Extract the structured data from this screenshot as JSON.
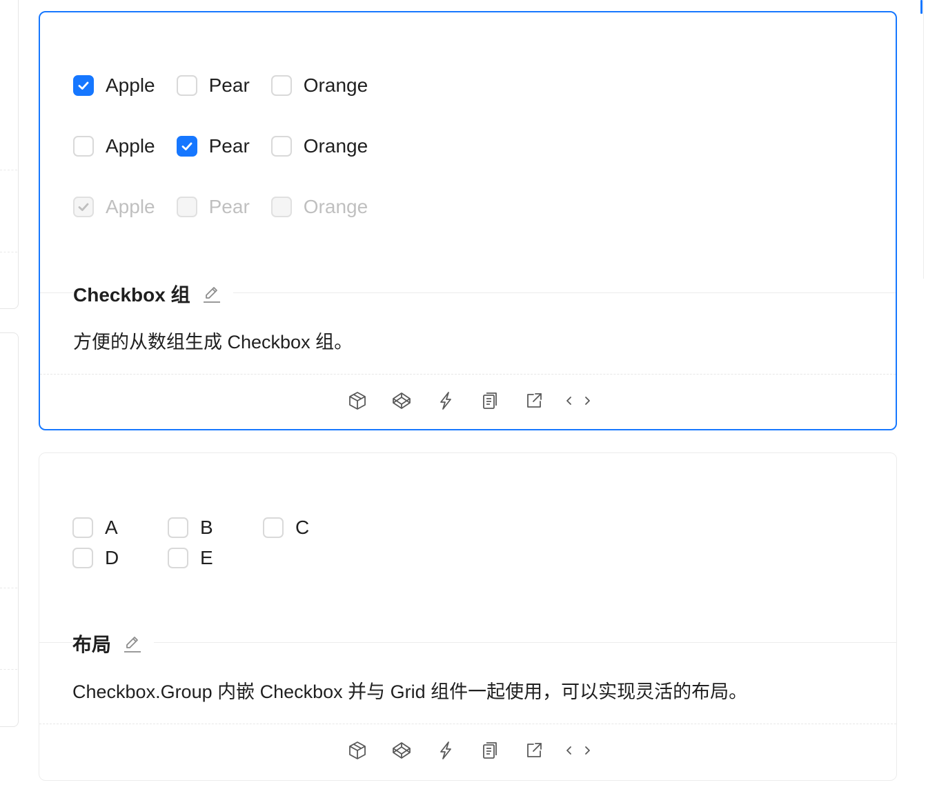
{
  "colors": {
    "primary": "#1677ff",
    "border": "#d9d9d9",
    "disabled_text": "rgba(0,0,0,0.25)"
  },
  "demo1": {
    "rows": [
      [
        {
          "label": "Apple",
          "checked": true,
          "disabled": false
        },
        {
          "label": "Pear",
          "checked": false,
          "disabled": false
        },
        {
          "label": "Orange",
          "checked": false,
          "disabled": false
        }
      ],
      [
        {
          "label": "Apple",
          "checked": false,
          "disabled": false
        },
        {
          "label": "Pear",
          "checked": true,
          "disabled": false
        },
        {
          "label": "Orange",
          "checked": false,
          "disabled": false
        }
      ],
      [
        {
          "label": "Apple",
          "checked": true,
          "disabled": true
        },
        {
          "label": "Pear",
          "checked": false,
          "disabled": true
        },
        {
          "label": "Orange",
          "checked": false,
          "disabled": true
        }
      ]
    ],
    "title": "Checkbox 组",
    "description": "方便的从数组生成 Checkbox 组。"
  },
  "demo2": {
    "items": [
      "A",
      "B",
      "C",
      "D",
      "E"
    ],
    "title": "布局",
    "description": "Checkbox.Group 内嵌 Checkbox 并与 Grid 组件一起使用，可以实现灵活的布局。"
  },
  "actions": [
    "codesandbox-icon",
    "codepen-icon",
    "stackblitz-icon",
    "copy-icon",
    "open-in-new-window-icon",
    "code-expand-icon"
  ]
}
